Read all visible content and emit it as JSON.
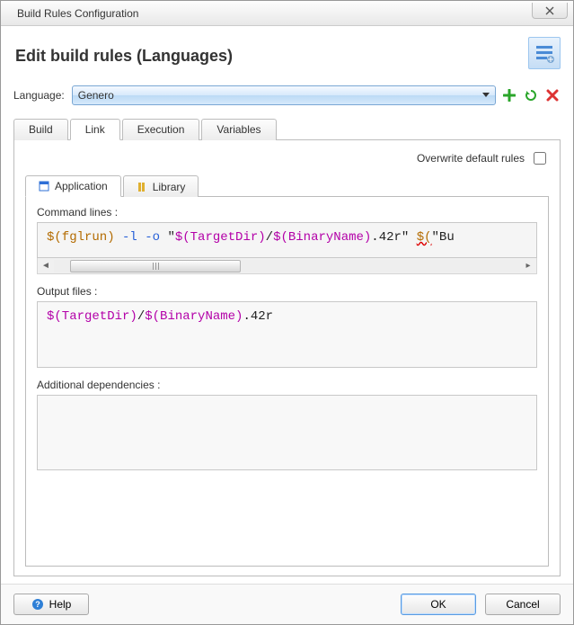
{
  "window": {
    "title": "Build Rules Configuration"
  },
  "header": {
    "title": "Edit build rules (Languages)"
  },
  "language": {
    "label": "Language:",
    "value": "Genero"
  },
  "tabs": {
    "build": "Build",
    "link": "Link",
    "execution": "Execution",
    "variables": "Variables"
  },
  "overwrite": {
    "label": "Overwrite default rules",
    "checked": false
  },
  "subtabs": {
    "application": "Application",
    "library": "Library"
  },
  "fields": {
    "cmd_label": "Command lines :",
    "out_label": "Output files :",
    "dep_label": "Additional dependencies :"
  },
  "command_line": {
    "seg1_var": "$(fglrun)",
    "seg2_opt": " -l -o ",
    "seg3_q": "\"",
    "seg3_path_a": "$(TargetDir)",
    "seg3_slash": "/",
    "seg3_path_b": "$(BinaryName)",
    "seg3_ext": ".42r",
    "seg3_q2": "\" ",
    "seg4_err": "$(",
    "seg4_tail": "\"Bu"
  },
  "output_line": {
    "a": "$(TargetDir)",
    "slash": "/",
    "b": "$(BinaryName)",
    "ext": ".42r"
  },
  "footer": {
    "help": "Help",
    "ok": "OK",
    "cancel": "Cancel"
  },
  "colors": {
    "accent": "#5a9be0"
  }
}
